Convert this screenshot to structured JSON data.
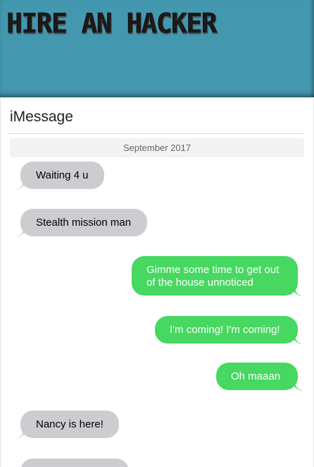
{
  "header": {
    "title": "HIRE AN HACKER"
  },
  "panel": {
    "title": "iMessage",
    "date_label": "September 2017"
  },
  "colors": {
    "banner": "#4398b0",
    "received_bubble": "#cdcdd1",
    "sent_bubble": "#46d860"
  },
  "messages": [
    {
      "direction": "received",
      "text": "Waiting 4 u"
    },
    {
      "direction": "received",
      "text": "Stealth mission man"
    },
    {
      "direction": "sent",
      "line1": "Gimme some time to get out",
      "line2": "of the house unnoticed"
    },
    {
      "direction": "sent",
      "text": "I'm coming! I'm coming!"
    },
    {
      "direction": "sent",
      "text": "Oh maaan"
    },
    {
      "direction": "received",
      "text": "Nancy is here!"
    }
  ]
}
